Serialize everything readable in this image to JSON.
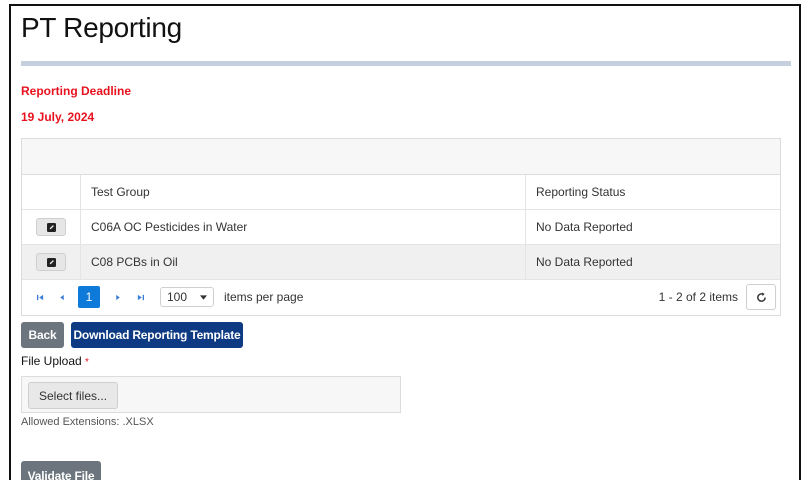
{
  "page": {
    "title": "PT Reporting"
  },
  "deadline": {
    "label": "Reporting Deadline",
    "date": "19 July, 2024"
  },
  "grid": {
    "columns": [
      "",
      "Test Group",
      "Reporting Status"
    ],
    "rows": [
      {
        "test_group": "C06A OC Pesticides in Water",
        "status": "No Data Reported"
      },
      {
        "test_group": "C08 PCBs in Oil",
        "status": "No Data Reported"
      }
    ],
    "pager": {
      "current_page": "1",
      "page_size": "100",
      "page_size_label": "items per page",
      "info": "1 - 2 of 2 items",
      "icons": [
        "first-page-icon",
        "prev-page-icon",
        "next-page-icon",
        "last-page-icon",
        "refresh-icon"
      ]
    }
  },
  "actions": {
    "back_label": "Back",
    "download_label": "Download Reporting Template"
  },
  "upload": {
    "label": "File Upload",
    "required_marker": "*",
    "select_label": "Select files...",
    "allowed": "Allowed Extensions: .XLSX",
    "validate_label": "Validate File"
  },
  "colors": {
    "accent": "#0d79d8",
    "primary": "#0d3a82",
    "secondary": "#6c757d",
    "danger": "#e8121f"
  }
}
